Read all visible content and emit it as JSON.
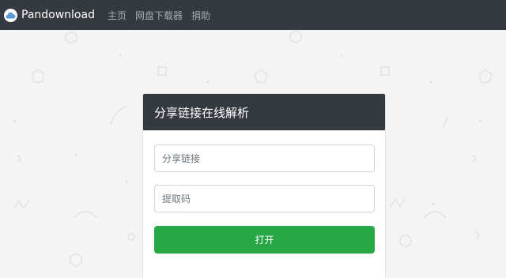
{
  "navbar": {
    "brand": "Pandownload",
    "links": [
      "主页",
      "网盘下载器",
      "捐助"
    ]
  },
  "card": {
    "title": "分享链接在线解析",
    "share_link_placeholder": "分享链接",
    "code_placeholder": "提取码",
    "submit_label": "打开"
  },
  "colors": {
    "navbar": "#343a40",
    "page_background": "#f4f4f4",
    "submit_button": "#28a745"
  }
}
